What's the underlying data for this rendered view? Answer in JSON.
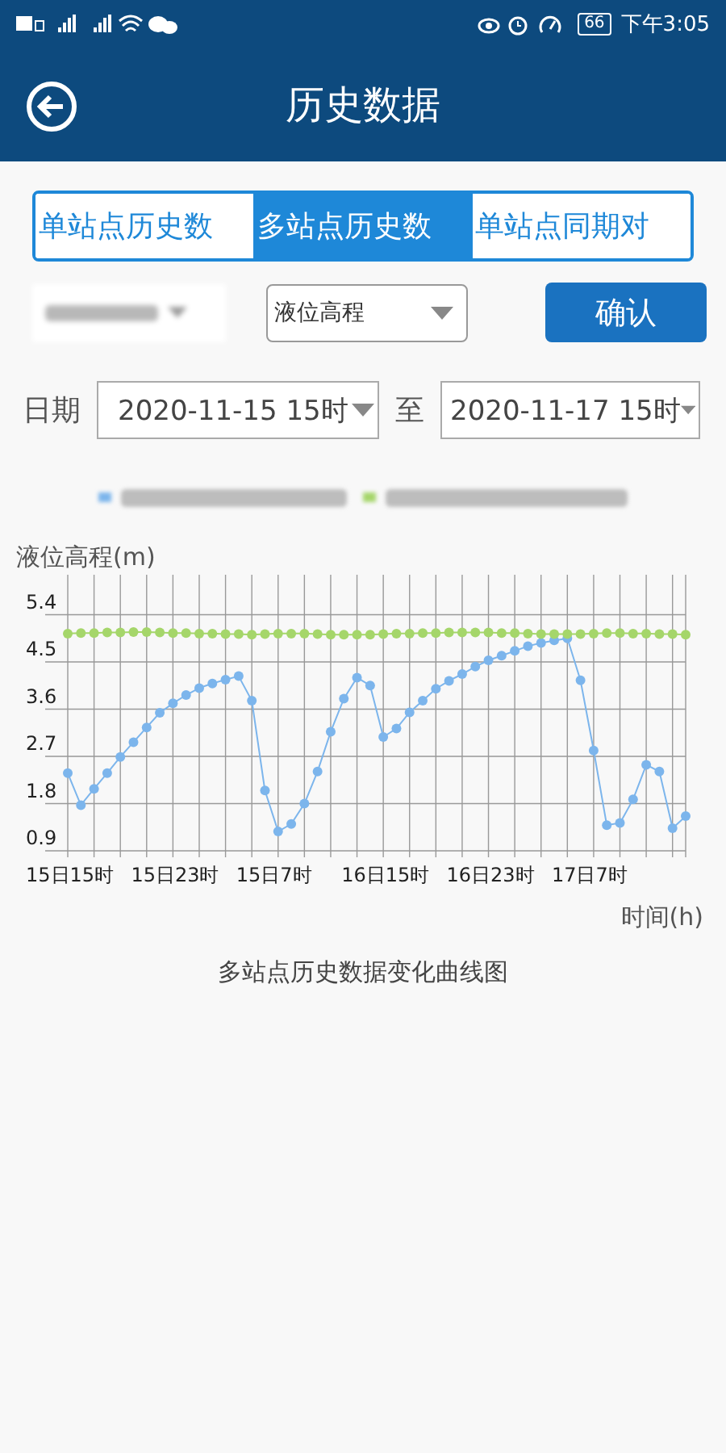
{
  "status_bar": {
    "battery": "66",
    "time": "下午3:05"
  },
  "header": {
    "title": "历史数据"
  },
  "tabs": [
    {
      "label": "单站点历史数",
      "selected": false
    },
    {
      "label": "多站点历史数",
      "selected": true
    },
    {
      "label": "单站点同期对",
      "selected": false
    }
  ],
  "filters": {
    "measure": "液位高程",
    "confirm": "确认"
  },
  "date_range": {
    "label": "日期",
    "start": "2020-11-15 15时",
    "separator": "至",
    "end": "2020-11-17 15时"
  },
  "chart": {
    "caption": "多站点历史数据变化曲线图",
    "chart_data": {
      "type": "line",
      "grid": true,
      "ylabel": "液位高程(m)",
      "xlabel": "时间(h)",
      "ylim": [
        0.9,
        6.1
      ],
      "yticks": [
        0.9,
        1.8,
        2.7,
        3.6,
        4.5,
        5.4
      ],
      "categories": [
        "15日15时",
        null,
        null,
        null,
        null,
        null,
        null,
        null,
        "15日23时",
        null,
        null,
        null,
        null,
        null,
        null,
        null,
        "15日7时",
        null,
        null,
        null,
        null,
        null,
        null,
        null,
        "16日15时",
        null,
        null,
        null,
        null,
        null,
        null,
        null,
        "16日23时",
        null,
        null,
        null,
        null,
        null,
        null,
        null,
        "17日7时",
        null,
        null,
        null,
        null,
        null,
        null,
        null
      ],
      "series": [
        {
          "color": "#7cb5ec",
          "marker": true,
          "values": [
            2.38,
            1.77,
            2.08,
            2.38,
            2.69,
            2.97,
            3.25,
            3.53,
            3.71,
            3.87,
            4.0,
            4.09,
            4.16,
            4.23,
            3.76,
            2.05,
            1.27,
            1.41,
            1.8,
            2.41,
            3.17,
            3.8,
            4.2,
            4.05,
            3.07,
            3.23,
            3.54,
            3.76,
            3.99,
            4.14,
            4.27,
            4.41,
            4.53,
            4.62,
            4.71,
            4.8,
            4.86,
            4.91,
            4.95,
            4.15,
            2.81,
            1.39,
            1.43,
            1.88,
            2.54,
            2.41,
            1.33,
            1.56
          ]
        },
        {
          "color": "#a5d66a",
          "marker": true,
          "values": [
            5.04,
            5.05,
            5.05,
            5.06,
            5.06,
            5.07,
            5.07,
            5.06,
            5.05,
            5.05,
            5.04,
            5.04,
            5.03,
            5.03,
            5.02,
            5.03,
            5.04,
            5.04,
            5.04,
            5.03,
            5.02,
            5.02,
            5.02,
            5.02,
            5.03,
            5.04,
            5.04,
            5.05,
            5.05,
            5.06,
            5.06,
            5.06,
            5.06,
            5.05,
            5.05,
            5.04,
            5.03,
            5.03,
            5.03,
            5.03,
            5.04,
            5.05,
            5.05,
            5.04,
            5.04,
            5.03,
            5.03,
            5.02
          ]
        }
      ]
    }
  }
}
